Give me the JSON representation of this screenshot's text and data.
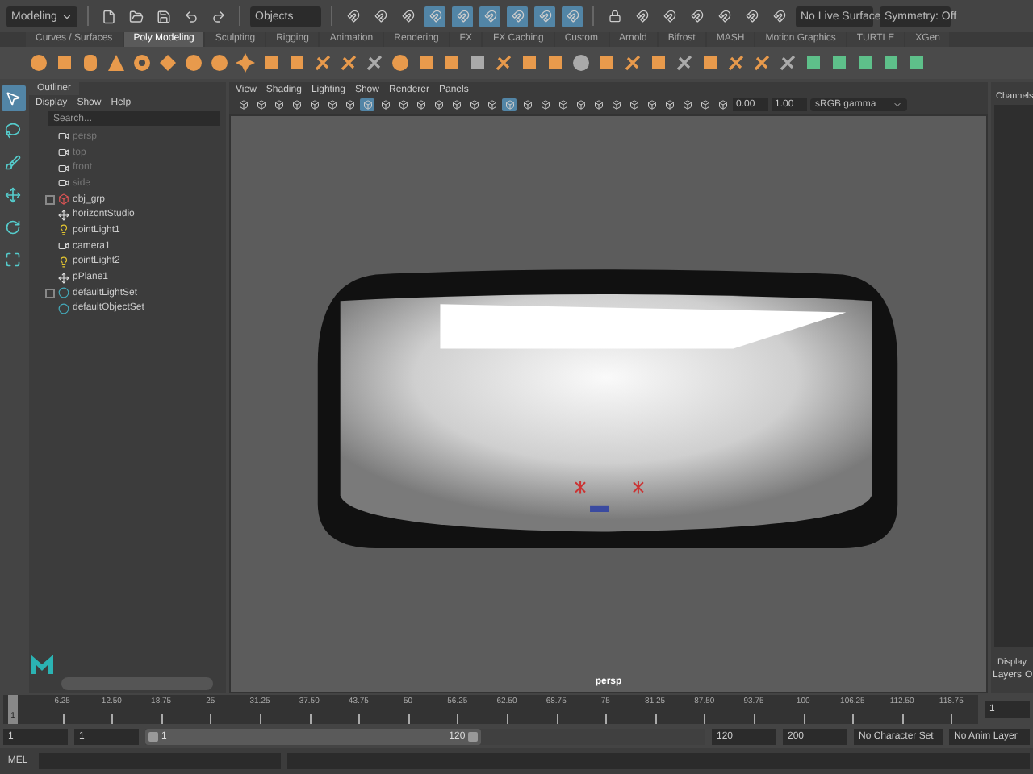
{
  "status_line": {
    "menu_set": "Modeling",
    "selection_field": "Objects",
    "live_surface": "No Live Surface",
    "symmetry": "Symmetry: Off"
  },
  "shelf": {
    "tabs": [
      {
        "label": "Curves / Surfaces",
        "selected": false
      },
      {
        "label": "Poly Modeling",
        "selected": true
      },
      {
        "label": "Sculpting",
        "selected": false
      },
      {
        "label": "Rigging",
        "selected": false
      },
      {
        "label": "Animation",
        "selected": false
      },
      {
        "label": "Rendering",
        "selected": false
      },
      {
        "label": "FX",
        "selected": false
      },
      {
        "label": "FX Caching",
        "selected": false
      },
      {
        "label": "Custom",
        "selected": false
      },
      {
        "label": "Arnold",
        "selected": false
      },
      {
        "label": "Bifrost",
        "selected": false
      },
      {
        "label": "MASH",
        "selected": false
      },
      {
        "label": "Motion Graphics",
        "selected": false
      },
      {
        "label": "TURTLE",
        "selected": false
      },
      {
        "label": "XGen",
        "selected": false
      }
    ]
  },
  "toolbox": {
    "tools": [
      {
        "kind": "select",
        "selected": true
      },
      {
        "kind": "lasso",
        "selected": false
      },
      {
        "kind": "paint",
        "selected": false
      },
      {
        "kind": "move",
        "selected": false
      },
      {
        "kind": "rotate",
        "selected": false
      },
      {
        "kind": "scale",
        "selected": false
      }
    ]
  },
  "outliner": {
    "title": "Outliner",
    "menu": [
      "Display",
      "Show",
      "Help"
    ],
    "search": {
      "placeholder": "Search..."
    },
    "items": [
      {
        "name": "persp",
        "kind": "camera",
        "dimmed": true
      },
      {
        "name": "top",
        "kind": "camera",
        "dimmed": true
      },
      {
        "name": "front",
        "kind": "camera",
        "dimmed": true
      },
      {
        "name": "side",
        "kind": "camera",
        "dimmed": true
      },
      {
        "name": "obj_grp",
        "kind": "group",
        "dimmed": false,
        "expanded": false
      },
      {
        "name": "horizontStudio",
        "kind": "transform",
        "dimmed": false
      },
      {
        "name": "pointLight1",
        "kind": "light",
        "dimmed": false
      },
      {
        "name": "camera1",
        "kind": "camera",
        "dimmed": false
      },
      {
        "name": "pointLight2",
        "kind": "light",
        "dimmed": false
      },
      {
        "name": "pPlane1",
        "kind": "transform",
        "dimmed": false
      },
      {
        "name": "defaultLightSet",
        "kind": "set",
        "dimmed": false,
        "expanded": false
      },
      {
        "name": "defaultObjectSet",
        "kind": "set",
        "dimmed": false
      }
    ]
  },
  "viewport": {
    "menu": [
      "View",
      "Shading",
      "Lighting",
      "Show",
      "Renderer",
      "Panels"
    ],
    "exposure": "0.00",
    "gamma": "1.00",
    "color_space": "sRGB gamma",
    "camera_label": "persp"
  },
  "channel_box": {
    "title": "Channels",
    "tab": "Display",
    "menu": [
      "Layers",
      "O"
    ]
  },
  "time_slider": {
    "current_frame": "1",
    "level": 0,
    "ticks": [
      "6.25",
      "12.50",
      "18.75",
      "25",
      "31.25",
      "37.50",
      "43.75",
      "50",
      "56.25",
      "62.50",
      "68.75",
      "75",
      "81.25",
      "87.50",
      "93.75",
      "100",
      "106.25",
      "112.50",
      "118.75"
    ],
    "frame_field": "1"
  },
  "range_slider": {
    "level": 0.6,
    "start": "1",
    "range_start": "1",
    "handle_start": "1",
    "handle_end": "120",
    "range_end": "120",
    "end": "200",
    "character_set": "No Character Set",
    "anim_layer": "No Anim Layer"
  },
  "command_line": {
    "label": "MEL"
  }
}
